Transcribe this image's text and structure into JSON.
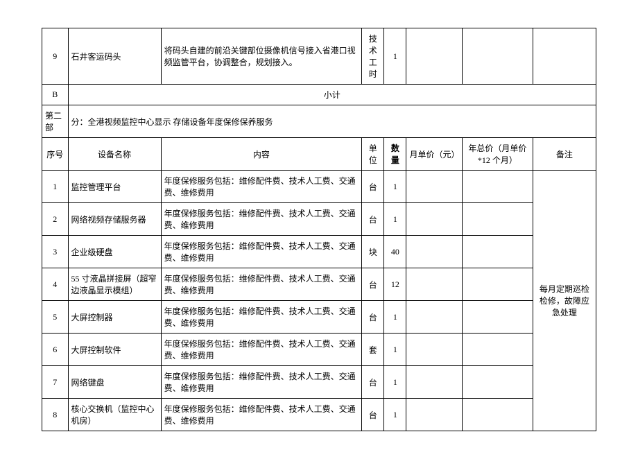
{
  "topRows": [
    {
      "seq": "9",
      "name": "石井客运码头",
      "content": "将码头自建的前沿关键部位摄像机信号接入省港口视频监管平台，协调整合，规划接入。",
      "unit": "技术工时",
      "qty": "1",
      "price": "",
      "total": "",
      "remark": ""
    }
  ],
  "subtotal": {
    "label": "B",
    "text": "小计"
  },
  "section2": {
    "prefix": "第二部",
    "title": "分：全港视频监控中心显示    存储设备年度保修保养服务"
  },
  "headers": {
    "seq": "序号",
    "name": "设备名称",
    "content": "内容",
    "unit": "单位",
    "qty": "数量",
    "price": "月单价（元）",
    "total": "年总价（月单价*12 个月）",
    "remark": "备注"
  },
  "rows": [
    {
      "seq": "1",
      "name": "监控管理平台",
      "content": "年度保修服务包括：维修配件费、技术人工费、交通费、维修费用",
      "unit": "台",
      "qty": "1",
      "price": "",
      "total": ""
    },
    {
      "seq": "2",
      "name": "网络视频存储服务器",
      "content": "年度保修服务包括：维修配件费、技术人工费、交通费、维修费用",
      "unit": "台",
      "qty": "1",
      "price": "",
      "total": ""
    },
    {
      "seq": "3",
      "name": "企业级硬盘",
      "content": "年度保修服务包括：维修配件费、技术人工费、交通费、维修费用",
      "unit": "块",
      "qty": "40",
      "price": "",
      "total": ""
    },
    {
      "seq": "4",
      "name": "55 寸液晶拼接屏（超窄边液晶显示模组）",
      "content": "年度保修服务包括：维修配件费、技术人工费、交通费、维修费用",
      "unit": "台",
      "qty": "12",
      "price": "",
      "total": ""
    },
    {
      "seq": "5",
      "name": "大屏控制器",
      "content": "年度保修服务包括：维修配件费、技术人工费、交通费、维修费用",
      "unit": "台",
      "qty": "1",
      "price": "",
      "total": ""
    },
    {
      "seq": "6",
      "name": "大屏控制软件",
      "content": "年度保修服务包括：维修配件费、技术人工费、交通费、维修费用",
      "unit": "套",
      "qty": "1",
      "price": "",
      "total": ""
    },
    {
      "seq": "7",
      "name": "网络键盘",
      "content": "年度保修服务包括：维修配件费、技术人工费、交通费、维修费用",
      "unit": "台",
      "qty": "1",
      "price": "",
      "total": ""
    },
    {
      "seq": "8",
      "name": "核心交换机（监控中心机房）",
      "content": "年度保修服务包括：维修配件费、技术人工费、交通费、维修费用",
      "unit": "台",
      "qty": "1",
      "price": "",
      "total": ""
    }
  ],
  "mergedRemark": "每月定期巡检检修，故障应急处理"
}
